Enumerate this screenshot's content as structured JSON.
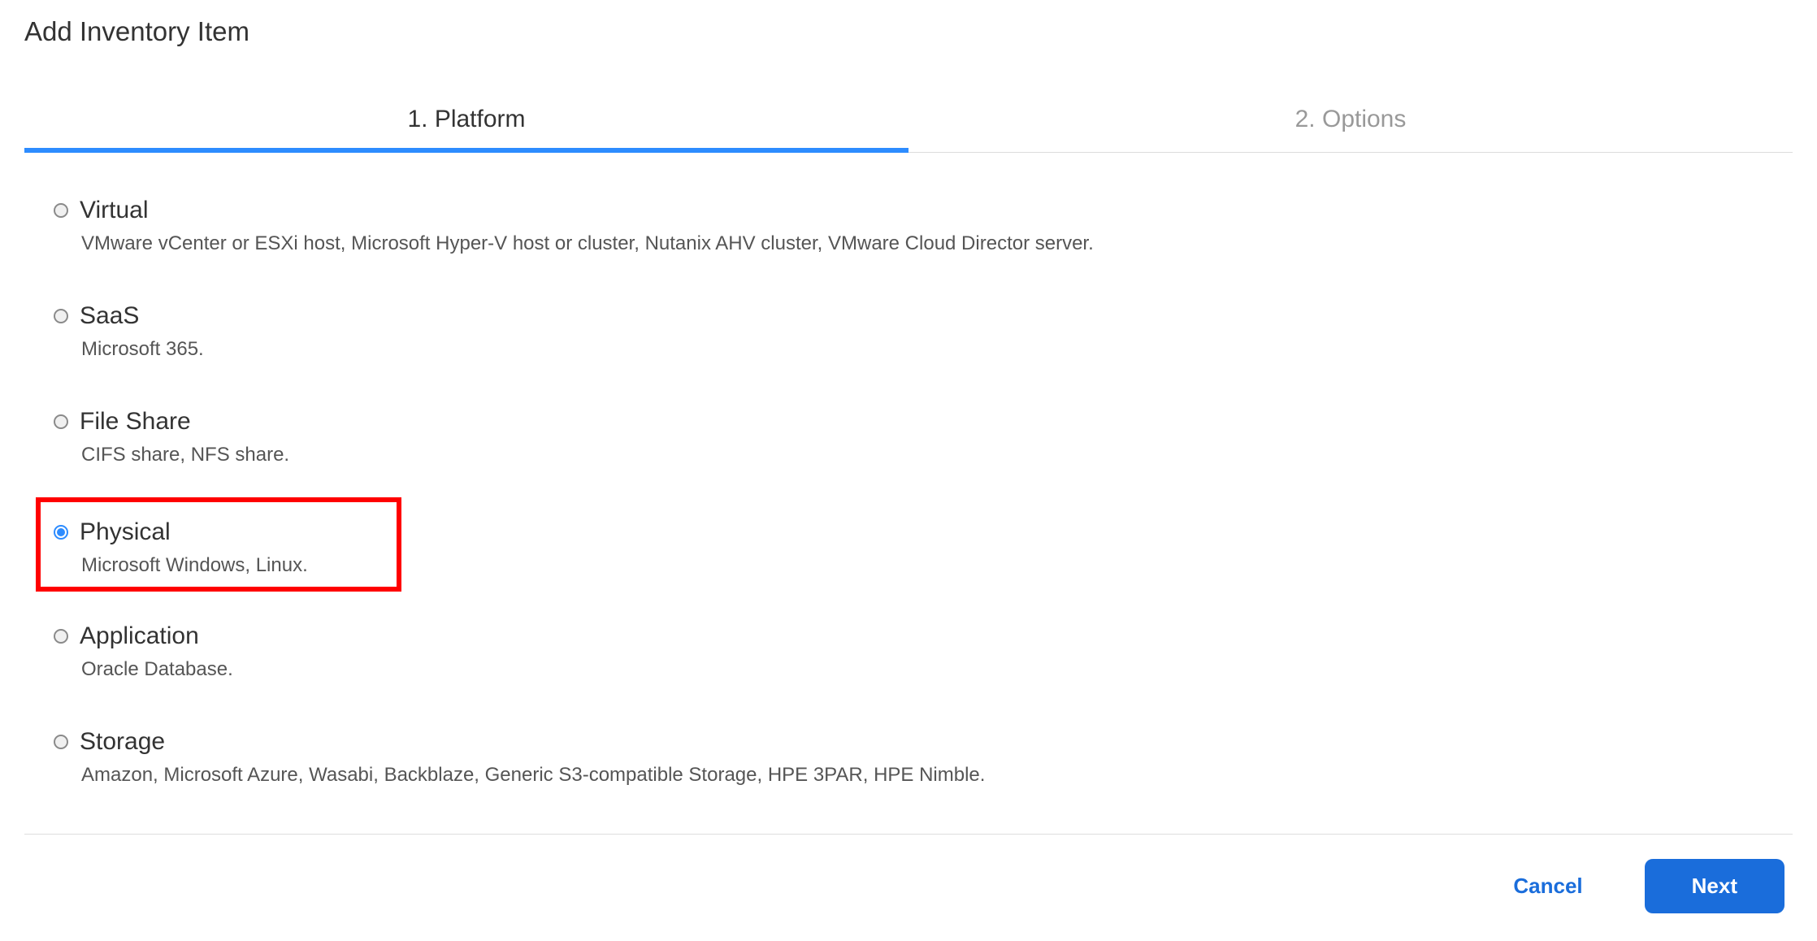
{
  "dialog": {
    "title": "Add Inventory Item"
  },
  "tabs": [
    {
      "label": "1. Platform",
      "active": true
    },
    {
      "label": "2. Options",
      "active": false
    }
  ],
  "options": [
    {
      "id": "virtual",
      "title": "Virtual",
      "desc": "VMware vCenter or ESXi host, Microsoft Hyper-V host or cluster, Nutanix AHV cluster, VMware Cloud Director server.",
      "selected": false
    },
    {
      "id": "saas",
      "title": "SaaS",
      "desc": "Microsoft 365.",
      "selected": false
    },
    {
      "id": "fileshare",
      "title": "File Share",
      "desc": "CIFS share, NFS share.",
      "selected": false
    },
    {
      "id": "physical",
      "title": "Physical",
      "desc": "Microsoft Windows, Linux.",
      "selected": true,
      "highlight": true
    },
    {
      "id": "application",
      "title": "Application",
      "desc": "Oracle Database.",
      "selected": false
    },
    {
      "id": "storage",
      "title": "Storage",
      "desc": "Amazon, Microsoft Azure, Wasabi, Backblaze, Generic S3-compatible Storage, HPE 3PAR, HPE Nimble.",
      "selected": false
    }
  ],
  "footer": {
    "cancel": "Cancel",
    "next": "Next"
  }
}
